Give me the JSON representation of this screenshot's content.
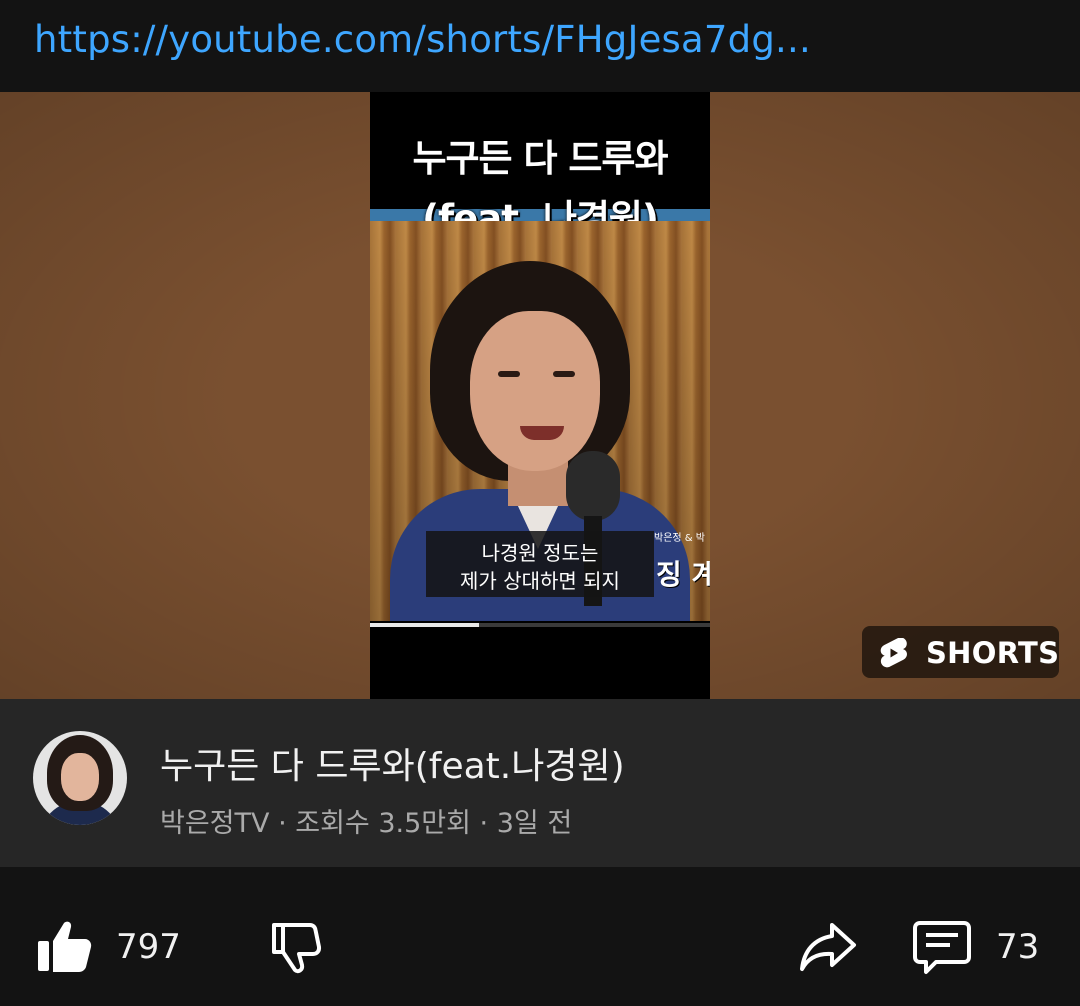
{
  "link": {
    "url_text": "https://youtube.com/shorts/FHgJesa7dg..."
  },
  "video": {
    "title_line1": "누구든 다 드루와",
    "title_line2": "(feat. 나경원)",
    "caption_line1": "나경원 정도는",
    "caption_line2": "제가 상대하면 되지",
    "side_small": "박은정 & 박",
    "side_big": "징 계",
    "progress_fraction": 0.32,
    "badge_label": "SHORTS"
  },
  "info": {
    "title": "누구든 다 드루와(feat.나경원)",
    "channel": "박은정TV",
    "views": "조회수 3.5만회",
    "age": "3일 전",
    "separator": " · "
  },
  "actions": {
    "like_count": "797",
    "comment_count": "73",
    "icons": [
      "thumbs-up-icon",
      "thumbs-down-icon",
      "share-icon",
      "comment-icon"
    ]
  },
  "colors": {
    "link": "#3ea6ff",
    "preview_bg": "#7a5030",
    "panel": "#262626",
    "bar": "#131313"
  }
}
